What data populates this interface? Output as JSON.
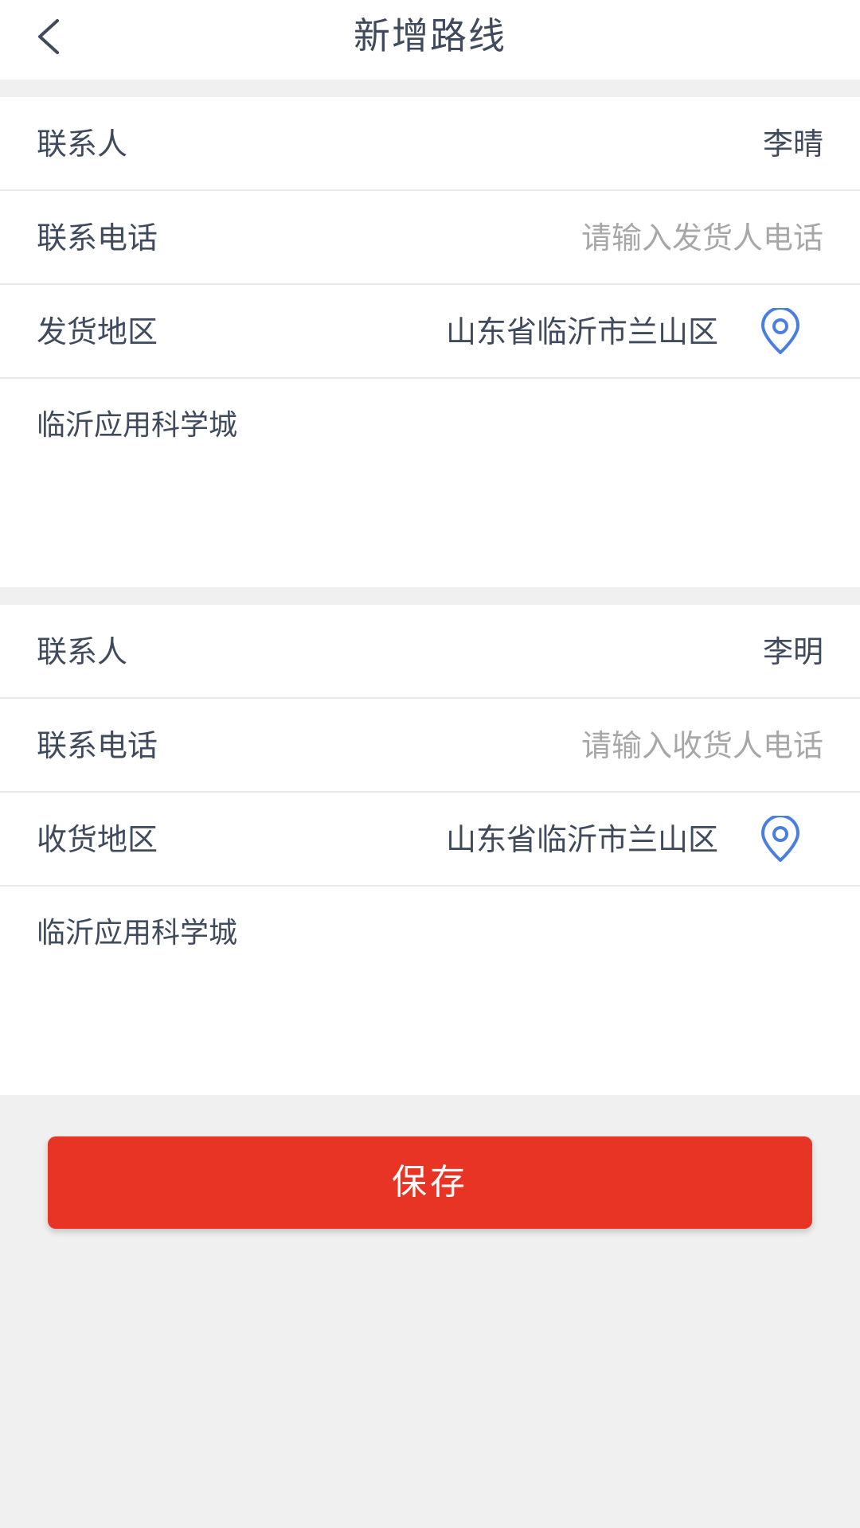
{
  "header": {
    "title": "新增路线",
    "back_icon": "chevron-left-icon"
  },
  "sender": {
    "contact_label": "联系人",
    "contact_value": "李晴",
    "phone_label": "联系电话",
    "phone_placeholder": "请输入发货人电话",
    "phone_value": "",
    "region_label": "发货地区",
    "region_value": "山东省临沂市兰山区",
    "location_icon": "location-pin-icon",
    "address": "临沂应用科学城"
  },
  "receiver": {
    "contact_label": "联系人",
    "contact_value": "李明",
    "phone_label": "联系电话",
    "phone_placeholder": "请输入收货人电话",
    "phone_value": "",
    "region_label": "收货地区",
    "region_value": "山东省临沂市兰山区",
    "location_icon": "location-pin-icon",
    "address": "临沂应用科学城"
  },
  "actions": {
    "save_label": "保存"
  },
  "colors": {
    "accent_red": "#e83425",
    "icon_blue": "#4a7fe0",
    "text_primary": "#3f4a5c",
    "placeholder": "#a7a7a7",
    "background": "#f0f0f0"
  }
}
